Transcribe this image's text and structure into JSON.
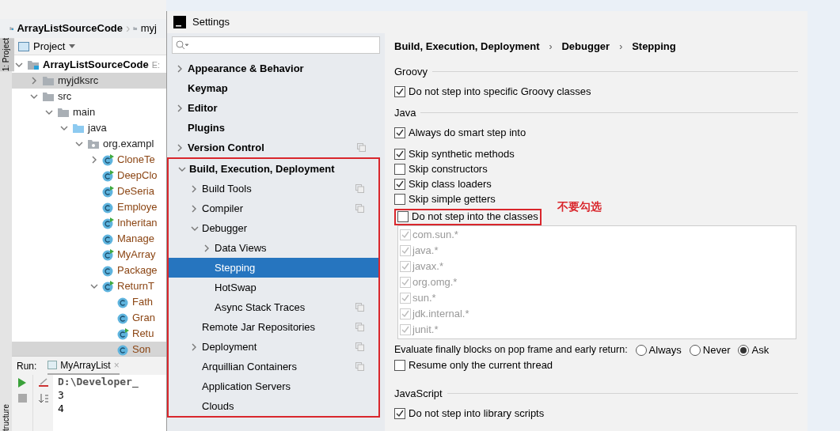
{
  "ide": {
    "breadcrumb": [
      "ArrayListSourceCode",
      "myj"
    ],
    "breadcrumb_separator": "›",
    "project_view": "Project",
    "left_tool_tab": "1: Project",
    "bottom_tool_tab": "tructure",
    "tree": [
      {
        "label": "ArrayListSourceCode",
        "kind": "module",
        "path": "E:",
        "expanded": true,
        "selected": false,
        "children": [
          {
            "label": "myjdksrc",
            "kind": "folder",
            "expanded": false,
            "selected": true
          },
          {
            "label": "src",
            "kind": "folder",
            "expanded": true,
            "selected": false,
            "children": [
              {
                "label": "main",
                "kind": "folder",
                "expanded": true,
                "selected": false,
                "children": [
                  {
                    "label": "java",
                    "kind": "source",
                    "expanded": true,
                    "selected": false,
                    "children": [
                      {
                        "label": "org.exampl",
                        "kind": "package",
                        "expanded": true,
                        "selected": false,
                        "children": [
                          {
                            "label": "CloneTe",
                            "kind": "runnable",
                            "expanded": false,
                            "selected": false
                          },
                          {
                            "label": "DeepClo",
                            "kind": "runnable",
                            "selected": false
                          },
                          {
                            "label": "DeSeria",
                            "kind": "runnable",
                            "selected": false
                          },
                          {
                            "label": "Employe",
                            "kind": "class",
                            "selected": false
                          },
                          {
                            "label": "Inheritan",
                            "kind": "runnable",
                            "selected": false
                          },
                          {
                            "label": "Manage",
                            "kind": "class",
                            "selected": false
                          },
                          {
                            "label": "MyArray",
                            "kind": "runnable",
                            "selected": false
                          },
                          {
                            "label": "Package",
                            "kind": "class",
                            "selected": false
                          },
                          {
                            "label": "ReturnT",
                            "kind": "runnable",
                            "expanded": true,
                            "selected": false,
                            "children": [
                              {
                                "label": "Fath",
                                "kind": "class",
                                "selected": false
                              },
                              {
                                "label": "Gran",
                                "kind": "class",
                                "selected": false
                              },
                              {
                                "label": "Retu",
                                "kind": "runnable",
                                "selected": false
                              },
                              {
                                "label": "Son",
                                "kind": "class",
                                "selected": true
                              }
                            ]
                          }
                        ]
                      }
                    ]
                  }
                ]
              }
            ]
          }
        ]
      }
    ],
    "run": {
      "label": "Run:",
      "tab": "MyArrayList",
      "close": "×",
      "console": [
        "D:\\Developer_",
        "3",
        "4"
      ]
    }
  },
  "settings": {
    "title": "Settings",
    "breadcrumb_separator": "›",
    "nav": [
      {
        "label": "Appearance & Behavior",
        "kind": "folder",
        "expanded": false,
        "shared": false,
        "selected": false
      },
      {
        "label": "Keymap",
        "kind": "page",
        "shared": false,
        "selected": false
      },
      {
        "label": "Editor",
        "kind": "folder",
        "expanded": false,
        "shared": false,
        "selected": false
      },
      {
        "label": "Plugins",
        "kind": "page",
        "shared": false,
        "selected": false
      },
      {
        "label": "Version Control",
        "kind": "folder",
        "expanded": false,
        "shared": true,
        "selected": false
      },
      {
        "label": "Build, Execution, Deployment",
        "kind": "folder",
        "expanded": true,
        "shared": false,
        "selected": false,
        "highlighted": true,
        "children": [
          {
            "label": "Build Tools",
            "kind": "folder",
            "expanded": false,
            "shared": true,
            "selected": false
          },
          {
            "label": "Compiler",
            "kind": "folder",
            "expanded": false,
            "shared": true,
            "selected": false
          },
          {
            "label": "Debugger",
            "kind": "folder",
            "expanded": true,
            "shared": false,
            "selected": false,
            "children": [
              {
                "label": "Data Views",
                "kind": "folder",
                "expanded": false,
                "shared": false,
                "selected": false
              },
              {
                "label": "Stepping",
                "kind": "page",
                "shared": false,
                "selected": true
              },
              {
                "label": "HotSwap",
                "kind": "page",
                "shared": false,
                "selected": false
              },
              {
                "label": "Async Stack Traces",
                "kind": "page",
                "shared": true,
                "selected": false
              }
            ]
          },
          {
            "label": "Remote Jar Repositories",
            "kind": "page",
            "shared": true,
            "selected": false
          },
          {
            "label": "Deployment",
            "kind": "folder",
            "expanded": false,
            "shared": true,
            "selected": false
          },
          {
            "label": "Arquillian Containers",
            "kind": "page",
            "shared": true,
            "selected": false
          },
          {
            "label": "Application Servers",
            "kind": "page",
            "shared": false,
            "selected": false
          },
          {
            "label": "Clouds",
            "kind": "page",
            "shared": false,
            "selected": false
          }
        ]
      }
    ],
    "breadcrumb": [
      "Build, Execution, Deployment",
      "Debugger",
      "Stepping"
    ],
    "groovy": {
      "title": "Groovy",
      "options": [
        {
          "label": "Do not step into specific Groovy classes",
          "checked": true
        }
      ]
    },
    "java": {
      "title": "Java",
      "smart_step": {
        "label": "Always do smart step into",
        "checked": true
      },
      "options": [
        {
          "label": "Skip synthetic methods",
          "checked": true
        },
        {
          "label": "Skip constructors",
          "checked": false
        },
        {
          "label": "Skip class loaders",
          "checked": true
        },
        {
          "label": "Skip simple getters",
          "checked": false
        }
      ],
      "step_classes": {
        "label": "Do not step into the classes",
        "checked": false,
        "highlighted": true,
        "note": "不要勾选"
      },
      "classes": [
        {
          "name": "com.sun.*",
          "checked": true
        },
        {
          "name": "java.*",
          "checked": true
        },
        {
          "name": "javax.*",
          "checked": true
        },
        {
          "name": "org.omg.*",
          "checked": true
        },
        {
          "name": "sun.*",
          "checked": true
        },
        {
          "name": "jdk.internal.*",
          "checked": true
        },
        {
          "name": "junit.*",
          "checked": true
        }
      ],
      "finally": {
        "label": "Evaluate finally blocks on pop frame and early return:",
        "options": [
          {
            "label": "Always",
            "selected": false
          },
          {
            "label": "Never",
            "selected": false
          },
          {
            "label": "Ask",
            "selected": true
          }
        ]
      },
      "resume": {
        "label": "Resume only the current thread",
        "checked": false
      }
    },
    "javascript": {
      "title": "JavaScript",
      "options": [
        {
          "label": "Do not step into library scripts",
          "checked": true
        }
      ]
    }
  }
}
